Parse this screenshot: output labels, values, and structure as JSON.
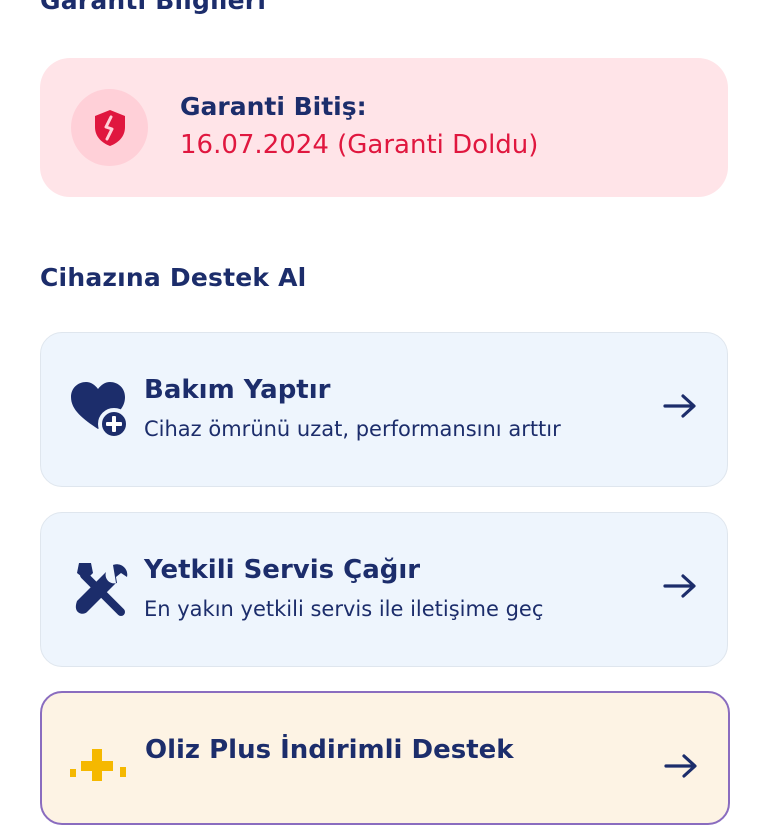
{
  "warranty": {
    "heading": "Garanti Bilgileri",
    "expiry_label": "Garanti Bitiş:",
    "expiry_value": "16.07.2024 (Garanti Doldu)",
    "icon": "broken-shield-icon"
  },
  "support": {
    "heading": "Cihazına Destek Al",
    "items": [
      {
        "title": "Bakım Yaptır",
        "subtitle": "Cihaz ömrünü uzat, performansını arttır",
        "icon": "heart-plus-icon"
      },
      {
        "title": "Yetkili Servis Çağır",
        "subtitle": "En yakın yetkili servis ile iletişime geç",
        "icon": "wrench-screwdriver-icon"
      },
      {
        "title": "Oliz Plus İndirimli Destek",
        "icon": "sparkle-plus-icon"
      }
    ]
  },
  "colors": {
    "primary": "#1c2d6b",
    "danger": "#e0173f",
    "warranty_bg": "#ffe4e8",
    "card_bg": "#eef5fd",
    "plus_bg": "#fdf3e4",
    "plus_border": "#8a6cbf",
    "accent_yellow": "#f5b800"
  }
}
